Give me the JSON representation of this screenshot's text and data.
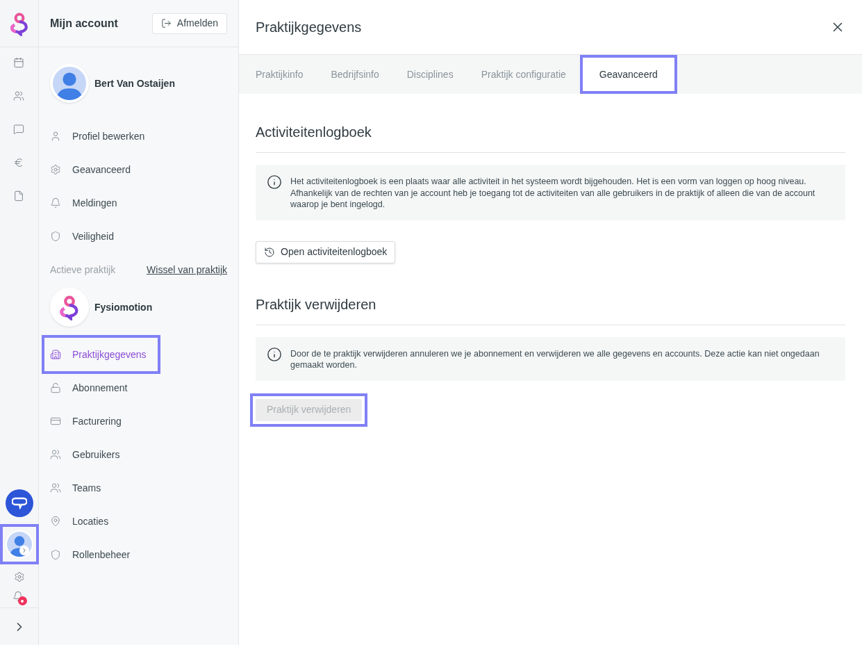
{
  "rail": {
    "user_highlighted": true,
    "notifications": true
  },
  "account": {
    "title": "Mijn account",
    "logout": "Afmelden",
    "user_name": "Bert Van Ostaijen",
    "items": [
      {
        "label": "Profiel bewerken",
        "selected": false
      },
      {
        "label": "Geavanceerd",
        "selected": false
      },
      {
        "label": "Meldingen",
        "selected": false
      },
      {
        "label": "Veiligheid",
        "selected": false
      }
    ]
  },
  "practice": {
    "section_label": "Actieve praktijk",
    "switch_link": "Wissel van praktijk",
    "name": "Fysiomotion",
    "items": [
      {
        "label": "Praktijkgegevens",
        "selected": true,
        "highlighted": true
      },
      {
        "label": "Abonnement",
        "selected": false,
        "highlighted": false
      },
      {
        "label": "Facturering",
        "selected": false,
        "highlighted": false
      },
      {
        "label": "Gebruikers",
        "selected": false,
        "highlighted": false
      },
      {
        "label": "Teams",
        "selected": false,
        "highlighted": false
      },
      {
        "label": "Locaties",
        "selected": false,
        "highlighted": false
      },
      {
        "label": "Rollenbeheer",
        "selected": false,
        "highlighted": false
      }
    ]
  },
  "panel": {
    "title": "Praktijkgegevens",
    "tabs": [
      {
        "label": "Praktijkinfo",
        "selected": false,
        "highlighted": false
      },
      {
        "label": "Bedrijfsinfo",
        "selected": false,
        "highlighted": false
      },
      {
        "label": "Disciplines",
        "selected": false,
        "highlighted": false
      },
      {
        "label": "Praktijk configuratie",
        "selected": false,
        "highlighted": false
      },
      {
        "label": "Geavanceerd",
        "selected": true,
        "highlighted": true
      }
    ],
    "sections": [
      {
        "heading": "Activiteitenlogboek",
        "info": "Het activiteitenlogboek is een plaats waar alle activiteit in het systeem wordt bijgehouden. Het is een vorm van loggen op hoog niveau. Afhankelijk van de rechten van je account heb je toegang tot de activiteiten van alle gebruikers in de praktijk of alleen die van de account waarop je bent ingelogd.",
        "button": {
          "label": "Open activiteitenlogboek",
          "kind": "history",
          "disabled": false,
          "highlighted": false
        }
      },
      {
        "heading": "Praktijk verwijderen",
        "info": "Door de te praktijk verwijderen annuleren we je abonnement en verwijderen we alle gegevens en accounts. Deze actie kan niet ongedaan gemaakt worden.",
        "button": {
          "label": "Praktijk verwijderen",
          "kind": "plain",
          "disabled": true,
          "highlighted": true
        }
      }
    ]
  }
}
